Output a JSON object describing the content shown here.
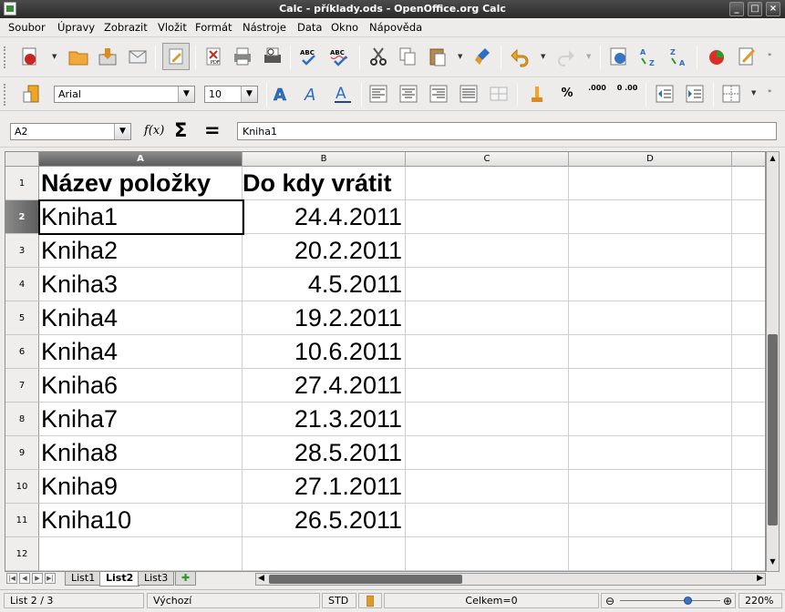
{
  "window": {
    "title": "Calc - příklady.ods - OpenOffice.org Calc"
  },
  "menu": [
    "Soubor",
    "Úpravy",
    "Zobrazit",
    "Vložit",
    "Formát",
    "Nástroje",
    "Data",
    "Okno",
    "Nápověda"
  ],
  "format": {
    "font_name": "Arial",
    "font_size": "10"
  },
  "formula": {
    "cell_ref": "A2",
    "content": "Kniha1"
  },
  "columns": [
    "A",
    "B",
    "C",
    "D"
  ],
  "rows": [
    "1",
    "2",
    "3",
    "4",
    "5",
    "6",
    "7",
    "8",
    "9",
    "10",
    "11",
    "12"
  ],
  "cells": {
    "A1": "Název položky",
    "B1": "Do kdy vrátit",
    "A2": "Kniha1",
    "B2": "24.4.2011",
    "A3": "Kniha2",
    "B3": "20.2.2011",
    "A4": "Kniha3",
    "B4": "4.5.2011",
    "A5": "Kniha4",
    "B5": "19.2.2011",
    "A6": "Kniha4",
    "B6": "10.6.2011",
    "A7": "Kniha6",
    "B7": "27.4.2011",
    "A8": "Kniha7",
    "B8": "21.3.2011",
    "A9": "Kniha8",
    "B9": "28.5.2011",
    "A10": "Kniha9",
    "B10": "27.1.2011",
    "A11": "Kniha10",
    "B11": "26.5.2011"
  },
  "sheets": {
    "tabs": [
      "List1",
      "List2",
      "List3"
    ],
    "active": "List2"
  },
  "status": {
    "sheet": "List 2 / 3",
    "style": "Výchozí",
    "mode": "STD",
    "sum": "Celkem=0",
    "zoom": "220%"
  },
  "toolbar": {
    "percent": "%",
    "decimal": ".000",
    "inc_decimal": "0 .00",
    "abc": "ABC"
  },
  "icons": [
    "new",
    "open",
    "save",
    "email",
    "edit",
    "pdf",
    "print",
    "print-preview",
    "spellcheck",
    "autospell",
    "cut",
    "copy",
    "paste",
    "format-paintbrush",
    "undo",
    "redo",
    "hyperlink",
    "sort-asc",
    "sort-desc",
    "chart",
    "draw"
  ]
}
